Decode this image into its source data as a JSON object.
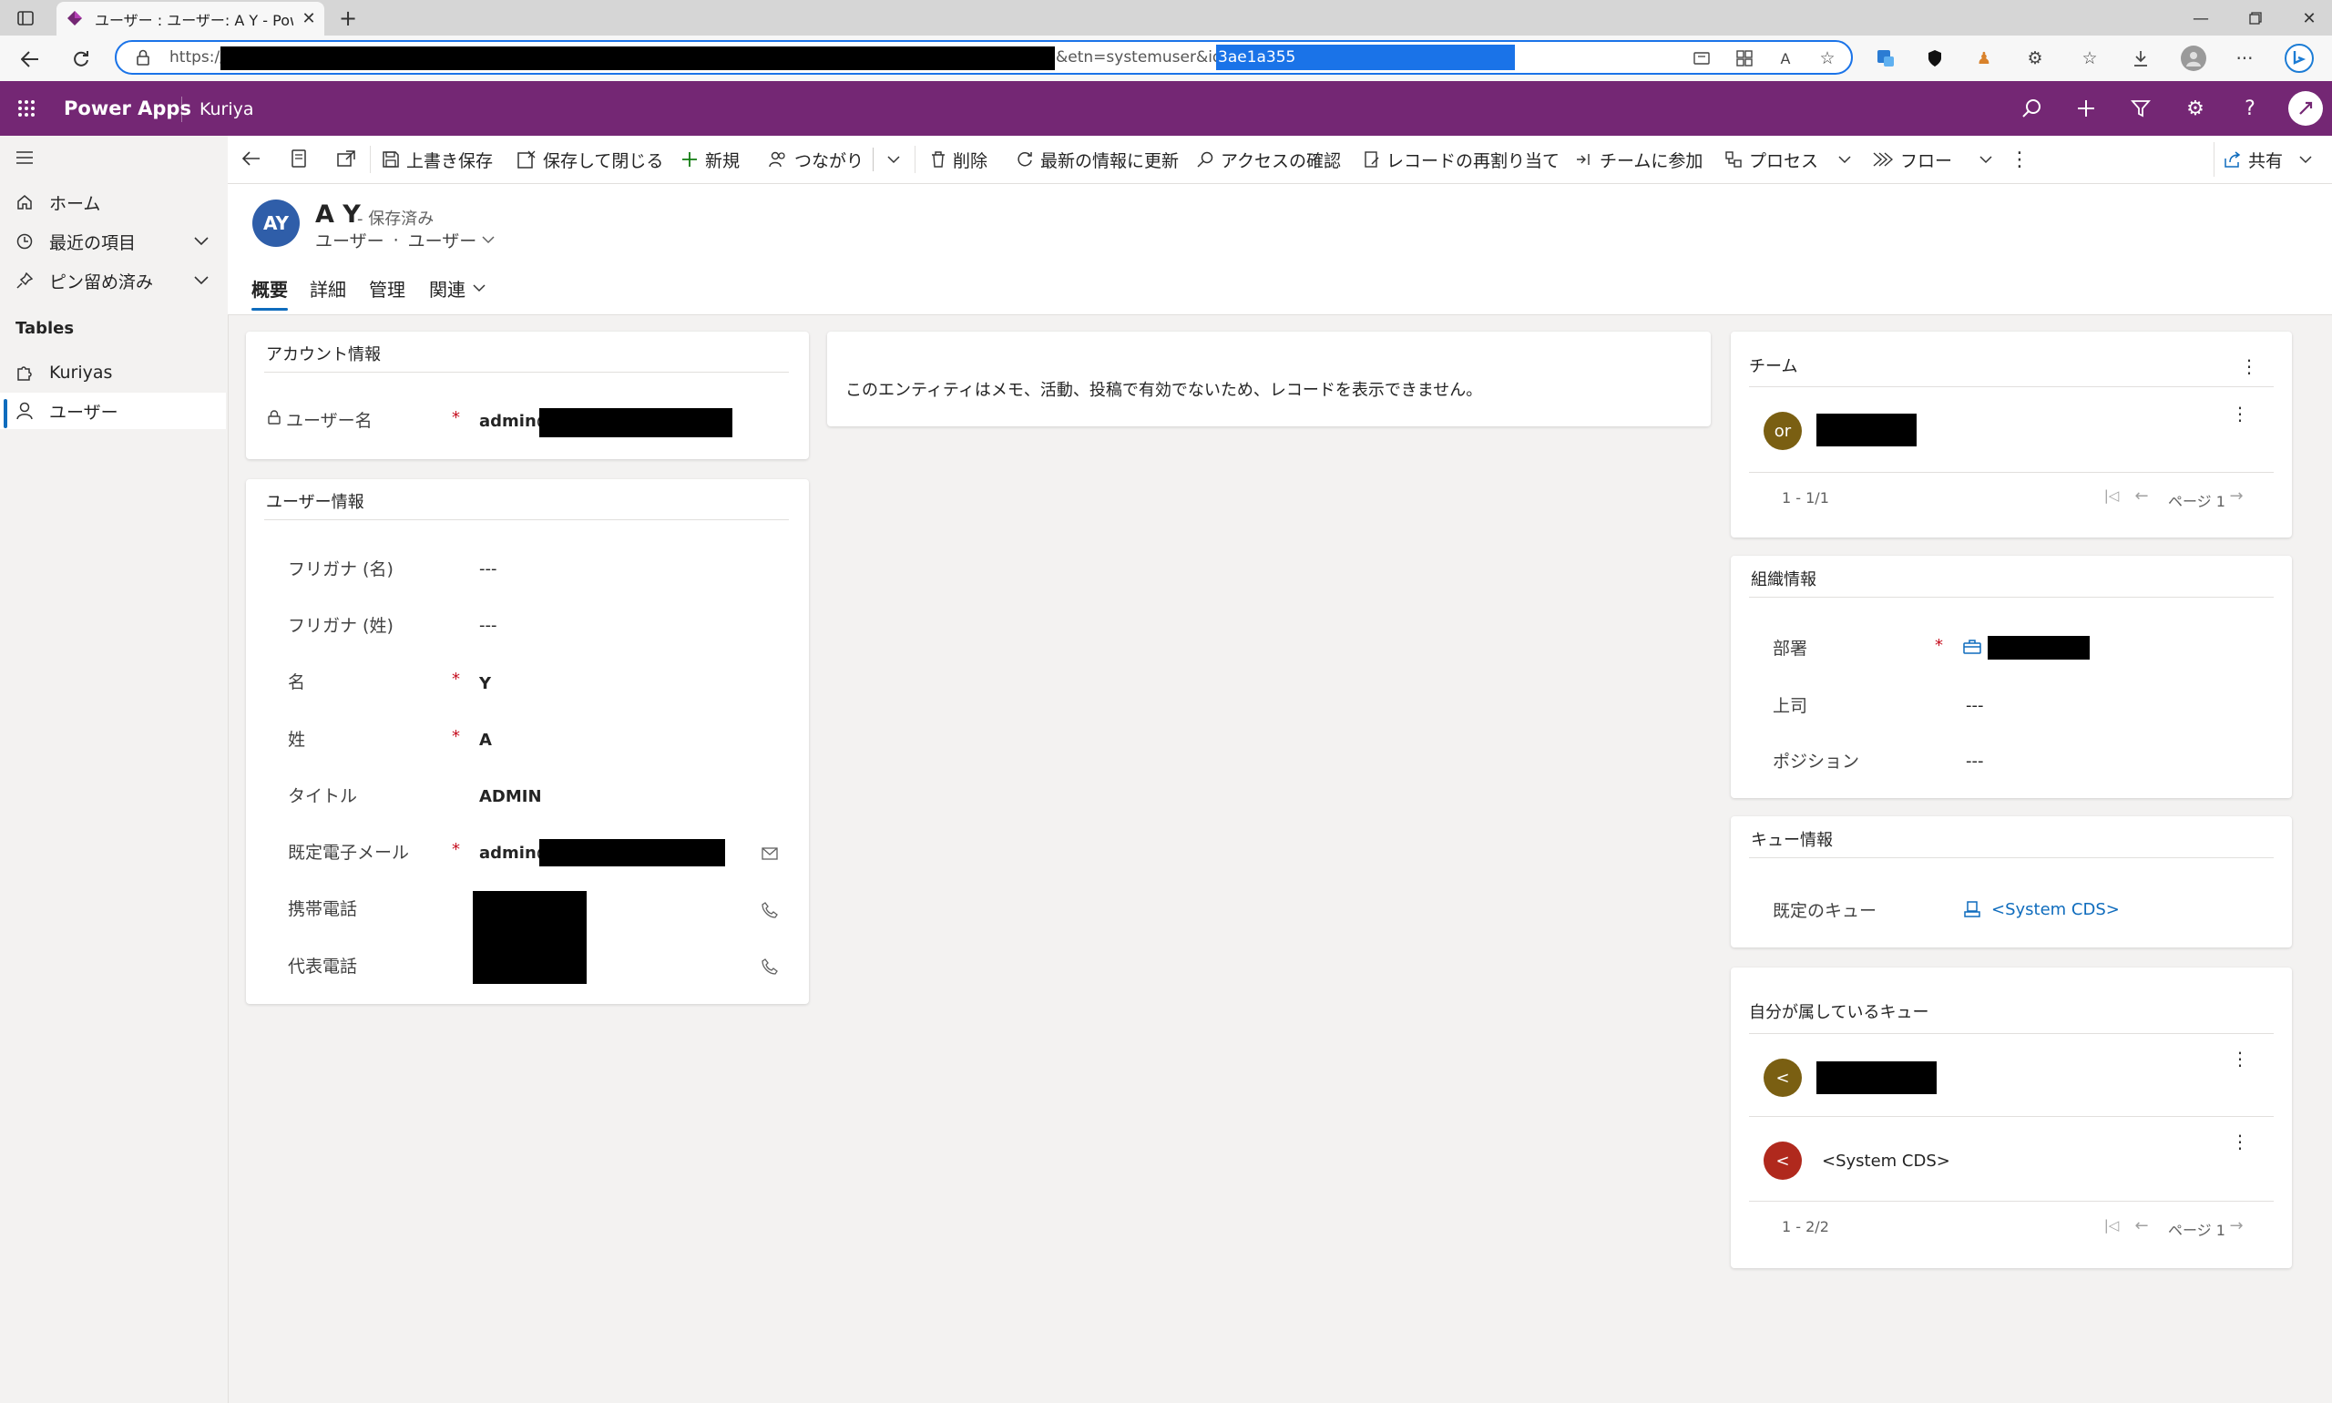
{
  "browser": {
    "tab_title": "ユーザー : ユーザー: A Y - Power Apps",
    "url_prefix": "https://",
    "url_mid": "&etn=systemuser&id=",
    "url_selected": "3ae1a355"
  },
  "app": {
    "name": "Power Apps",
    "environment": "Kuriya"
  },
  "sidebar": {
    "items": [
      {
        "label": "ホーム",
        "icon": "home-icon"
      },
      {
        "label": "最近の項目",
        "icon": "clock-icon"
      },
      {
        "label": "ピン留め済み",
        "icon": "pin-icon"
      }
    ],
    "section_title": "Tables",
    "tables": [
      {
        "label": "Kuriyas",
        "icon": "puzzle-icon"
      },
      {
        "label": "ユーザー",
        "icon": "person-icon",
        "selected": true
      }
    ]
  },
  "commands": {
    "save": "上書き保存",
    "save_close": "保存して閉じる",
    "new": "新規",
    "connect": "つながり",
    "delete": "削除",
    "refresh": "最新の情報に更新",
    "check_access": "アクセスの確認",
    "reassign": "レコードの再割り当て",
    "join_team": "チームに参加",
    "process": "プロセス",
    "flow": "フロー",
    "share": "共有"
  },
  "record": {
    "initials": "AY",
    "name": "A Y",
    "status": "- 保存済み",
    "entity": "ユーザー",
    "form": "ユーザー",
    "separator": "·"
  },
  "tabs": [
    "概要",
    "詳細",
    "管理",
    "関連"
  ],
  "account_section": {
    "title": "アカウント情報",
    "username_label": "ユーザー名",
    "username_value": "admin@"
  },
  "user_section": {
    "title": "ユーザー情報",
    "fields": [
      {
        "label": "フリガナ (名)",
        "value": "---"
      },
      {
        "label": "フリガナ (姓)",
        "value": "---"
      },
      {
        "label": "名",
        "value": "Y"
      },
      {
        "label": "姓",
        "value": "A"
      },
      {
        "label": "タイトル",
        "value": "ADMIN"
      },
      {
        "label": "既定電子メール",
        "value": "admin@"
      },
      {
        "label": "携帯電話",
        "value": ""
      },
      {
        "label": "代表電話",
        "value": ""
      }
    ]
  },
  "timeline_message": "このエンティティはメモ、活動、投稿で有効でないため、レコードを表示できません。",
  "team_section": {
    "title": "チーム",
    "member_initials": "or",
    "pager": "1 - 1/1",
    "page": "ページ 1"
  },
  "org_section": {
    "title": "組織情報",
    "dept_label": "部署",
    "manager_label": "上司",
    "manager_value": "---",
    "position_label": "ポジション",
    "position_value": "---"
  },
  "queue_section": {
    "title": "キュー情報",
    "default_label": "既定のキュー",
    "default_value": "<System CDS>"
  },
  "my_queues": {
    "title": "自分が属しているキュー",
    "item1_initials": "<",
    "item2_initials": "<",
    "item2_label": "<System CDS>",
    "pager": "1 - 2/2",
    "page": "ページ 1"
  },
  "colors": {
    "app_bar": "#742774",
    "avatar": "#2f5ea9",
    "team_avatar": "#7a5f12",
    "queue_avatar_red": "#b0291d",
    "link": "#0f6cbd",
    "required": "#c50f1f"
  }
}
